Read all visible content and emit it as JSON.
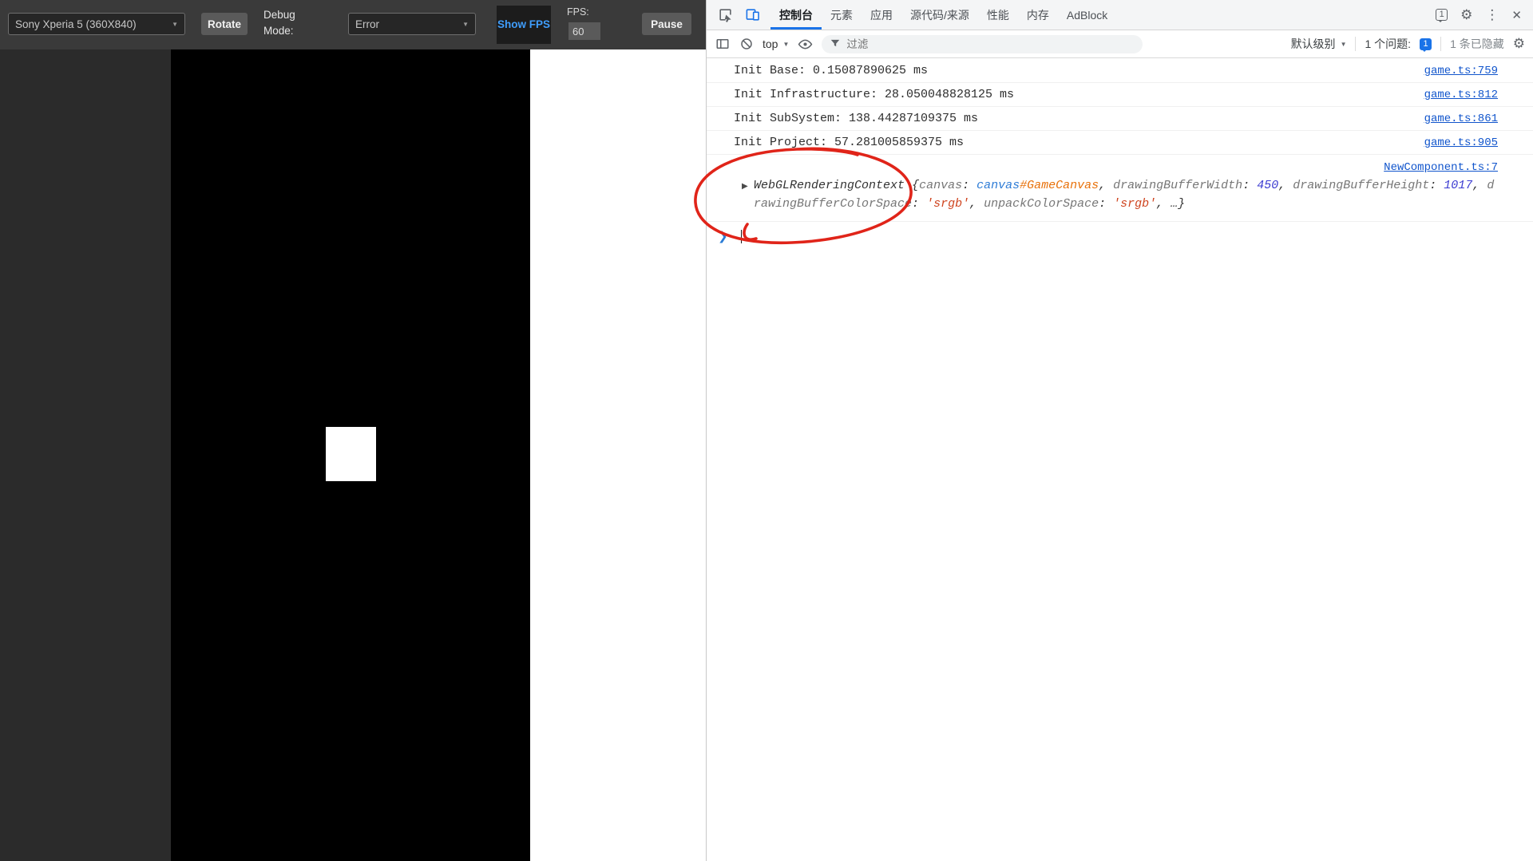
{
  "colors": {
    "accent_blue": "#1a73e8",
    "link_blue": "#1155cc",
    "fps_button_blue": "#3f9dfb",
    "annotation_red": "#e02419",
    "toolbar_dark": "#3a3a3a",
    "canvas_black": "#000000"
  },
  "icons": {
    "caret": "▼",
    "gear": "⚙",
    "kebab": "⋮",
    "close": "✕",
    "triangle_collapsed": "▶",
    "prompt_chevron": "❯"
  },
  "emulator": {
    "device_select_value": "Sony Xperia 5 (360X840)",
    "rotate_label": "Rotate",
    "debug_mode_label": "Debug Mode:",
    "debug_select_value": "Error",
    "show_fps_label": "Show FPS",
    "fps_label": "FPS:",
    "fps_value": "60",
    "pause_label": "Pause"
  },
  "devtools": {
    "tabbar": {
      "tabs": [
        "控制台",
        "元素",
        "应用",
        "源代码/来源",
        "性能",
        "内存",
        "AdBlock"
      ],
      "active_tab": "控制台",
      "issues_count": "1"
    },
    "toolbar": {
      "context_label": "top",
      "filter_placeholder": "过滤",
      "levels_label": "默认级别",
      "issues_label": "1 个问题:",
      "issues_badge": "1",
      "hidden_label": "1 条已隐藏"
    },
    "console": {
      "logs": [
        {
          "text": "Init Base: 0.15087890625 ms",
          "source": "game.ts:759"
        },
        {
          "text": "Init Infrastructure: 28.050048828125 ms",
          "source": "game.ts:812"
        },
        {
          "text": "Init SubSystem: 138.44287109375 ms",
          "source": "game.ts:861"
        },
        {
          "text": "Init Project: 57.281005859375 ms",
          "source": "game.ts:905"
        }
      ],
      "object_log": {
        "source": "NewComponent.ts:7",
        "tokens": [
          {
            "t": "WebGLRenderingContext ",
            "c": "obj"
          },
          {
            "t": "{",
            "c": "plain"
          },
          {
            "t": "canvas",
            "c": "key"
          },
          {
            "t": ": ",
            "c": "plain"
          },
          {
            "t": "canvas",
            "c": "tag"
          },
          {
            "t": "#GameCanvas",
            "c": "id"
          },
          {
            "t": ", ",
            "c": "plain"
          },
          {
            "t": "drawingBufferWidth",
            "c": "key"
          },
          {
            "t": ": ",
            "c": "plain"
          },
          {
            "t": "450",
            "c": "num"
          },
          {
            "t": ", ",
            "c": "plain"
          },
          {
            "t": "drawingBufferHeight",
            "c": "key"
          },
          {
            "t": ": ",
            "c": "plain"
          },
          {
            "t": "1017",
            "c": "num"
          },
          {
            "t": ", ",
            "c": "plain"
          },
          {
            "t": "drawingBufferColorSpace",
            "c": "key"
          },
          {
            "t": ": ",
            "c": "plain"
          },
          {
            "t": "'srgb'",
            "c": "str"
          },
          {
            "t": ", ",
            "c": "plain"
          },
          {
            "t": "unpackColorSpace",
            "c": "key"
          },
          {
            "t": ": ",
            "c": "plain"
          },
          {
            "t": "'srgb'",
            "c": "str"
          },
          {
            "t": ", ",
            "c": "plain"
          },
          {
            "t": "…}",
            "c": "plain"
          }
        ]
      }
    }
  },
  "annotation": {
    "shape": "hand-drawn-circle",
    "color": "#e02419"
  }
}
